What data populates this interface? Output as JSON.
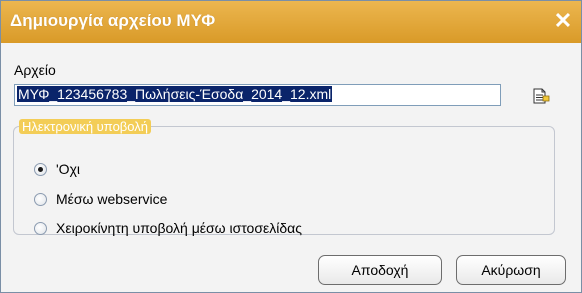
{
  "window": {
    "title": "Δημιουργία αρχείου ΜΥΦ",
    "close_icon": "close-icon"
  },
  "file": {
    "label": "Αρχείο",
    "value": "ΜΥΦ_123456783_Πωλήσεις-Έσοδα_2014_12.xml",
    "browse_icon": "file-browse-icon"
  },
  "submission": {
    "legend": "Ηλεκτρονική υποβολή",
    "options": [
      {
        "label": "'Οχι",
        "checked": true
      },
      {
        "label": "Μέσω webservice",
        "checked": false
      },
      {
        "label": "Χειροκίνητη υποβολή μέσω ιστοσελίδας",
        "checked": false
      }
    ]
  },
  "buttons": {
    "accept": "Αποδοχή",
    "cancel": "Ακύρωση"
  }
}
